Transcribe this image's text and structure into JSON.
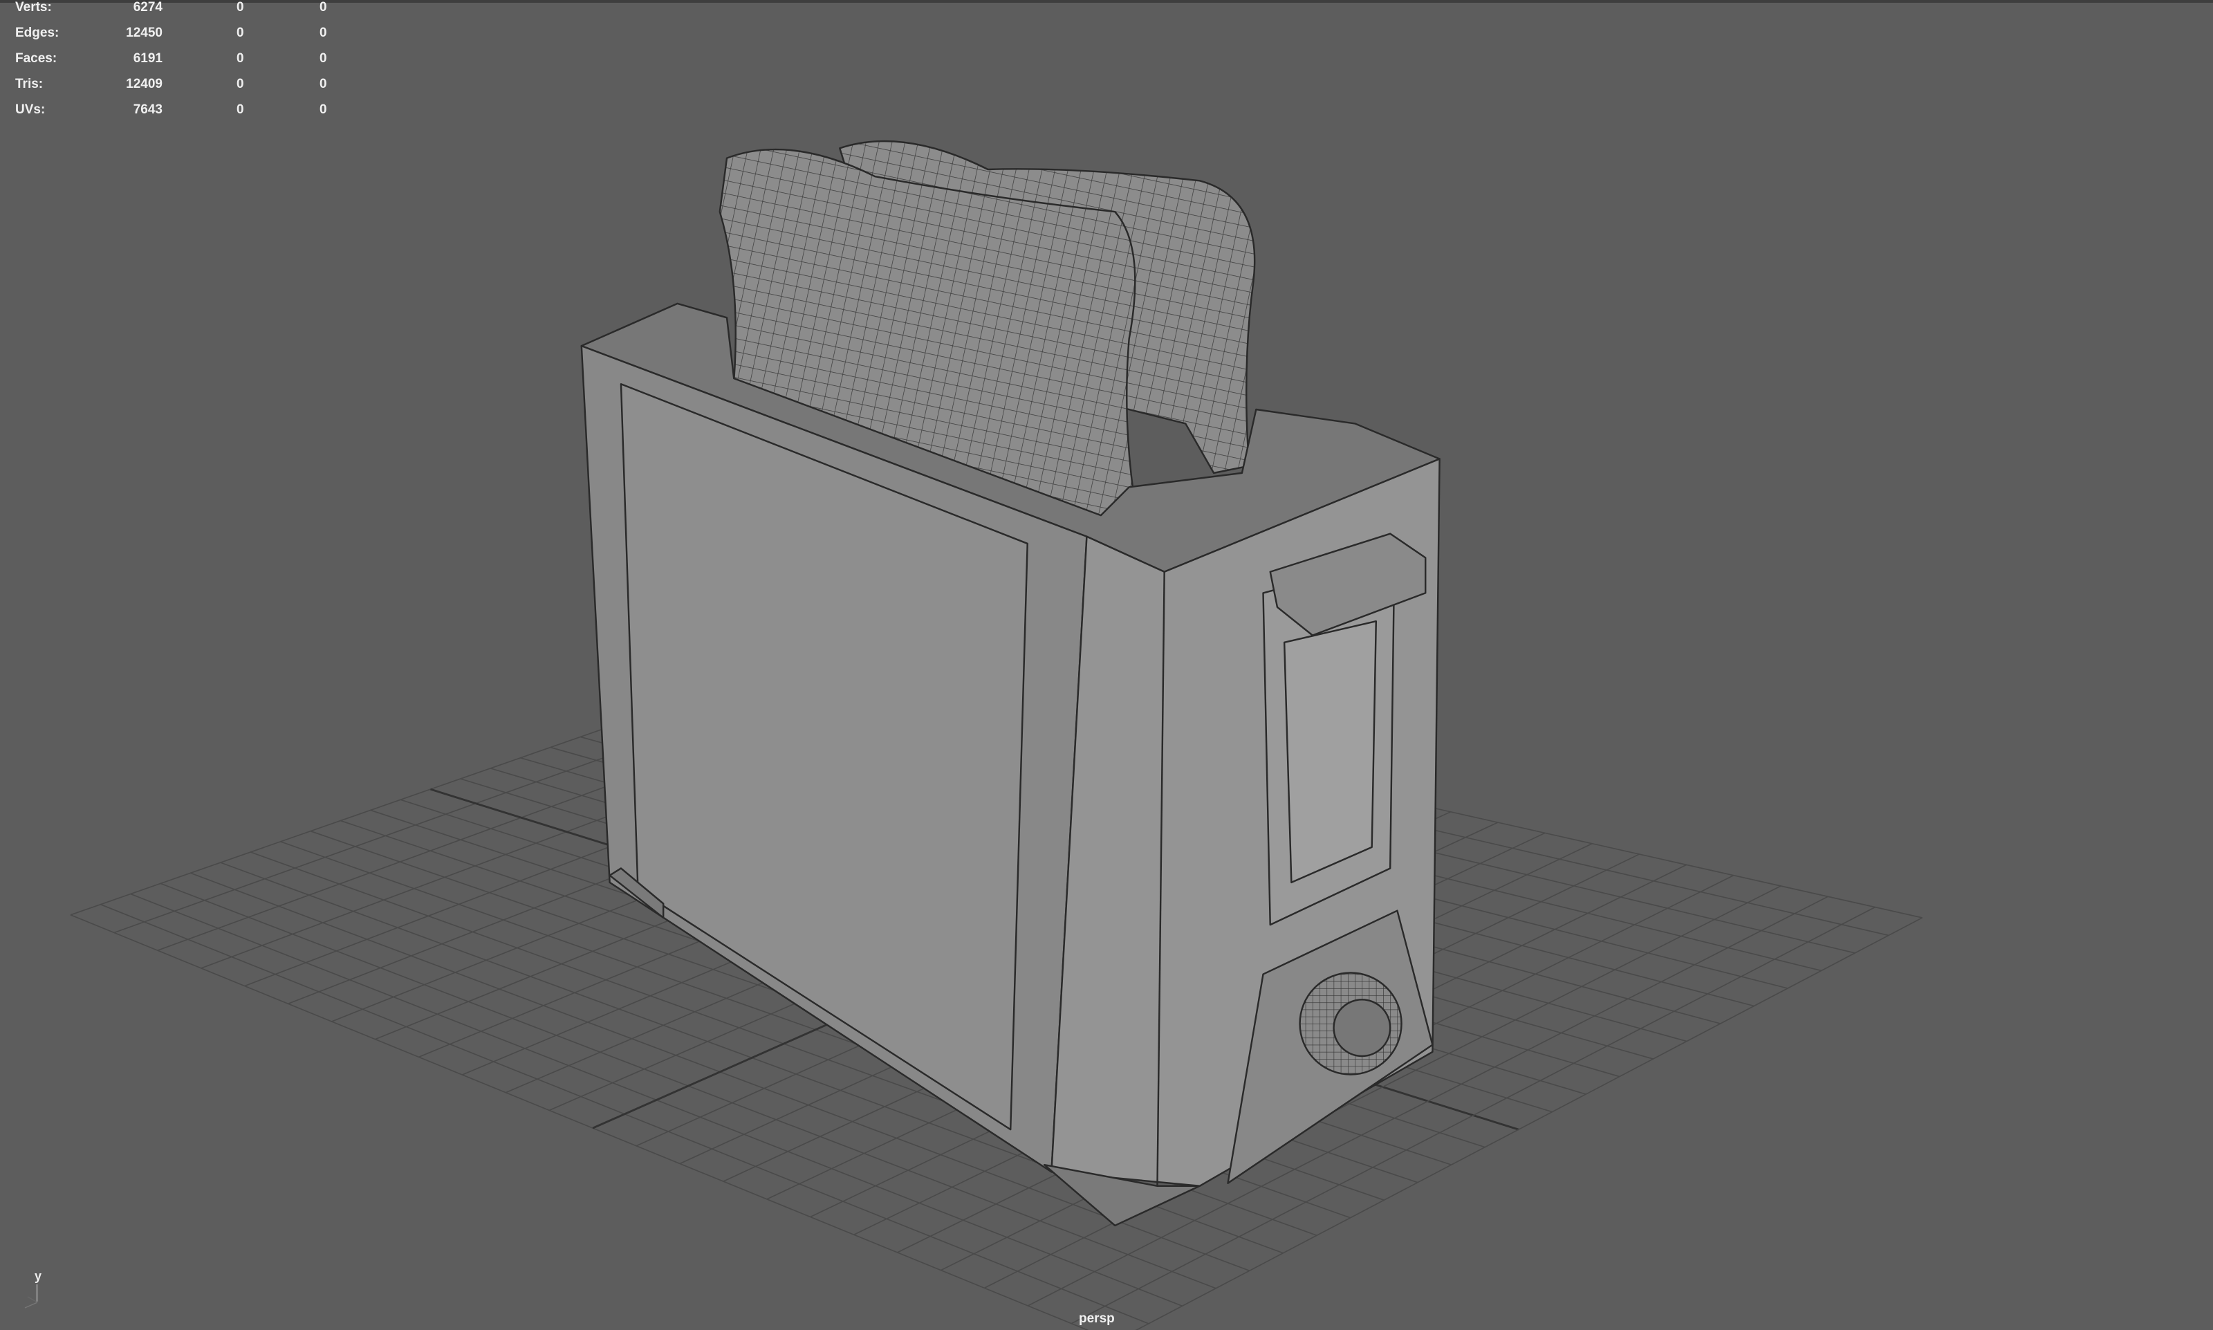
{
  "viewport": {
    "camera_label": "persp",
    "axis_label": "y",
    "background_color": "#5d5d5d"
  },
  "hud": {
    "rows": [
      {
        "label": "Verts:",
        "value": "6274",
        "selected": "0",
        "uv": "0"
      },
      {
        "label": "Edges:",
        "value": "12450",
        "selected": "0",
        "uv": "0"
      },
      {
        "label": "Faces:",
        "value": "6191",
        "selected": "0",
        "uv": "0"
      },
      {
        "label": "Tris:",
        "value": "12409",
        "selected": "0",
        "uv": "0"
      },
      {
        "label": "UVs:",
        "value": "7643",
        "selected": "0",
        "uv": "0"
      }
    ]
  }
}
